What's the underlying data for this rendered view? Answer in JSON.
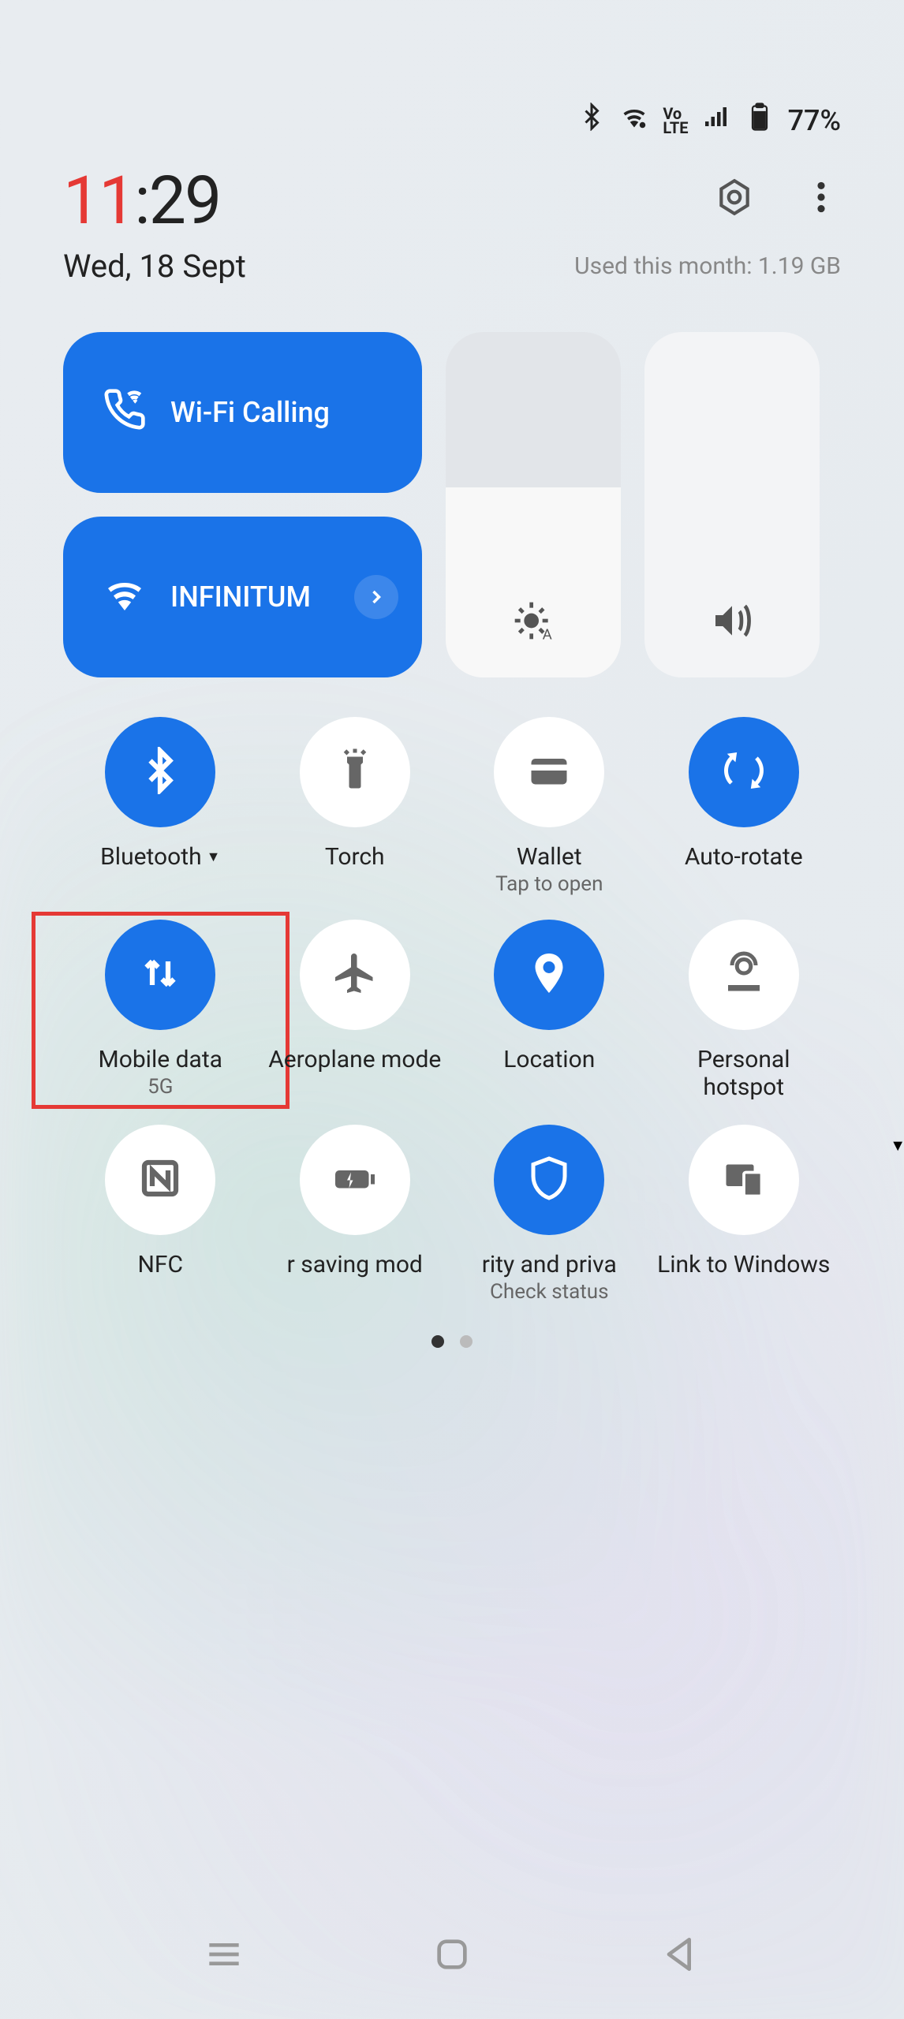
{
  "status": {
    "battery_pct": "77%",
    "volte": "VoLTE"
  },
  "header": {
    "hour": "11",
    "minute": ":29",
    "date": "Wed, 18 Sept",
    "usage": "Used this month: 1.19 GB"
  },
  "big_tiles": {
    "wifi_calling": "Wi-Fi Calling",
    "wifi_network": "INFINITUM"
  },
  "tiles": {
    "bluetooth": {
      "label": "Bluetooth"
    },
    "torch": {
      "label": "Torch"
    },
    "wallet": {
      "label": "Wallet",
      "sub": "Tap to open"
    },
    "autorotate": {
      "label": "Auto-rotate"
    },
    "mobiledata": {
      "label": "Mobile data",
      "sub": "5G"
    },
    "aeroplane": {
      "label": "Aeroplane mode"
    },
    "location": {
      "label": "Location"
    },
    "hotspot": {
      "label": "Personal hotspot"
    },
    "nfc": {
      "label": "NFC"
    },
    "powersave": {
      "label": "r saving mod"
    },
    "security": {
      "label": "rity and priva",
      "sub": "Check status"
    },
    "linkwin": {
      "label": "Link to Windows"
    }
  }
}
